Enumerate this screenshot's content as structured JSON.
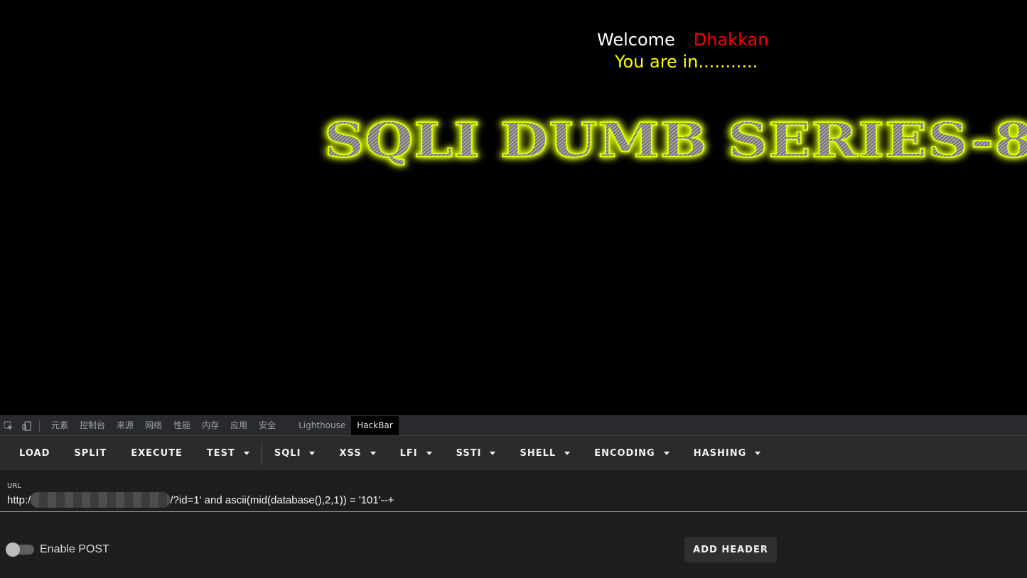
{
  "page": {
    "welcome_text": "Welcome",
    "user_name": "Dhakkan",
    "status_text": "You are in...........",
    "banner_text": "SQLI DUMB SERIES-8"
  },
  "devtools": {
    "tabs": [
      "元素",
      "控制台",
      "来源",
      "网络",
      "性能",
      "内存",
      "应用",
      "安全",
      "Lighthouse",
      "HackBar"
    ],
    "active_tab": "HackBar"
  },
  "hackbar": {
    "buttons": [
      {
        "label": "LOAD",
        "dropdown": false
      },
      {
        "label": "SPLIT",
        "dropdown": false
      },
      {
        "label": "EXECUTE",
        "dropdown": false
      },
      {
        "label": "TEST",
        "dropdown": true
      },
      {
        "label": "SQLI",
        "dropdown": true
      },
      {
        "label": "XSS",
        "dropdown": true
      },
      {
        "label": "LFI",
        "dropdown": true
      },
      {
        "label": "SSTI",
        "dropdown": true
      },
      {
        "label": "SHELL",
        "dropdown": true
      },
      {
        "label": "ENCODING",
        "dropdown": true
      },
      {
        "label": "HASHING",
        "dropdown": true
      }
    ],
    "url_label": "URL",
    "url_prefix": "http:/",
    "url_suffix": "/?id=1' and ascii(mid(database(),2,1)) = '101'--+",
    "enable_post_label": "Enable POST",
    "enable_post": false,
    "add_header_label": "ADD HEADER"
  },
  "colors": {
    "welcome": "#ffffff",
    "user_name": "#ff0000",
    "status": "#ffff00",
    "banner_glow": "#e6ff00"
  }
}
